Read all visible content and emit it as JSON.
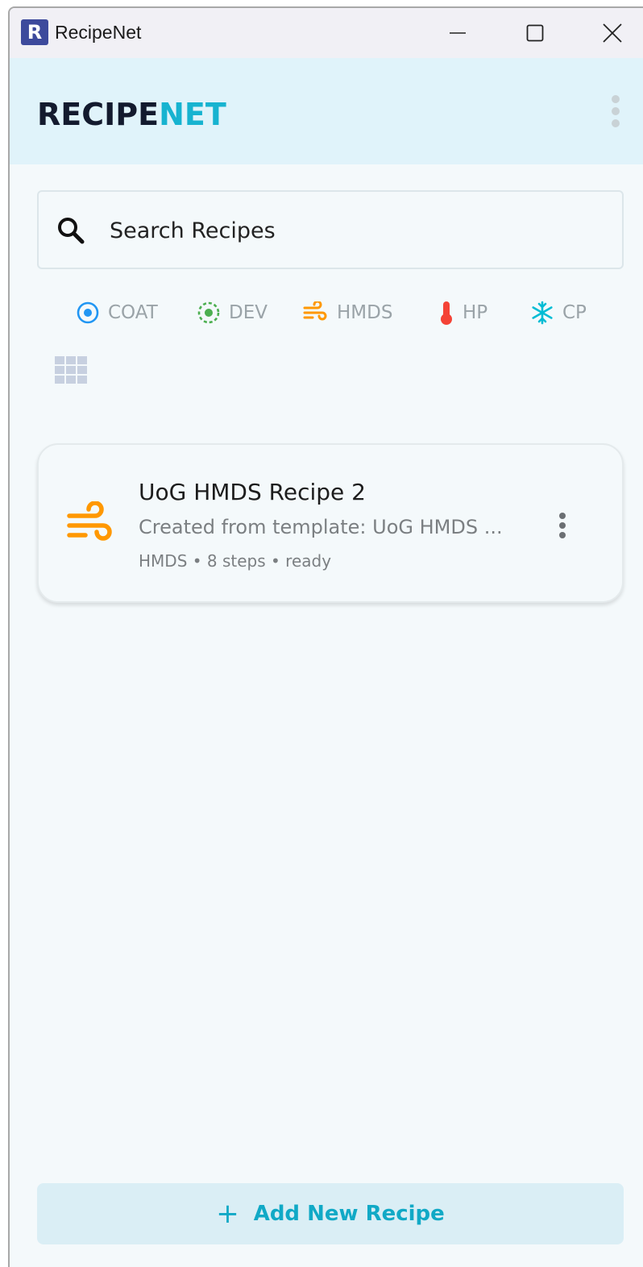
{
  "window": {
    "logo_letter": "R",
    "title": "RecipeNet"
  },
  "header": {
    "brand_part1": "RECIPE",
    "brand_part2": "NET"
  },
  "search": {
    "placeholder": "Search Recipes"
  },
  "filters": [
    {
      "label": "COAT",
      "icon": "target-icon",
      "color": "#2196f3"
    },
    {
      "label": "DEV",
      "icon": "dashed-target-icon",
      "color": "#4caf50"
    },
    {
      "label": "HMDS",
      "icon": "wind-icon",
      "color": "#ff9800"
    },
    {
      "label": "HP",
      "icon": "thermometer-icon",
      "color": "#f44336"
    },
    {
      "label": "CP",
      "icon": "snowflake-icon",
      "color": "#00bcd4"
    }
  ],
  "recipes": [
    {
      "title": "UoG HMDS Recipe 2",
      "description": "Created from template: UoG HMDS ...",
      "meta": "HMDS • 8 steps • ready",
      "icon": "wind-icon",
      "icon_color": "#ff9800"
    }
  ],
  "add_button": {
    "plus": "+",
    "label": "Add New Recipe"
  },
  "colors": {
    "accent": "#17b3d0",
    "header_bg": "#e0f3fa"
  }
}
